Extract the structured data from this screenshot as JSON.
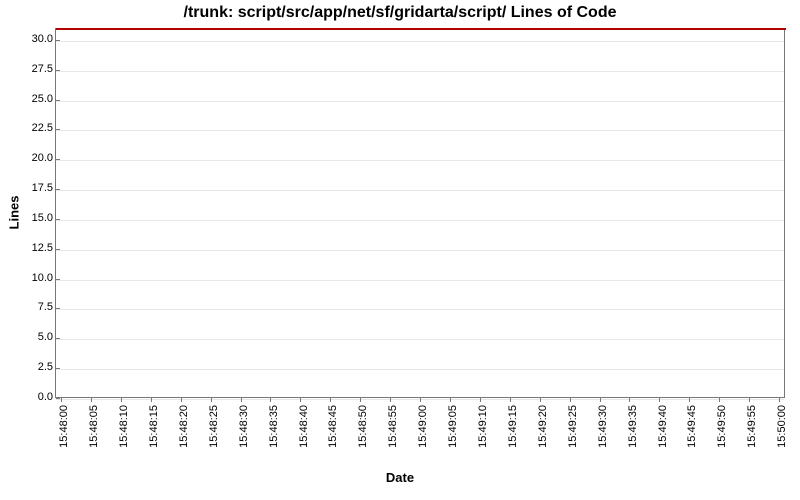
{
  "chart_data": {
    "type": "line",
    "title": "/trunk: script/src/app/net/sf/gridarta/script/ Lines of Code",
    "xlabel": "Date",
    "ylabel": "Lines",
    "ylim": [
      0.0,
      31.0
    ],
    "y_ticks": [
      0.0,
      2.5,
      5.0,
      7.5,
      10.0,
      12.5,
      15.0,
      17.5,
      20.0,
      22.5,
      25.0,
      27.5,
      30.0
    ],
    "x_categories": [
      "15:48:00",
      "15:48:05",
      "15:48:10",
      "15:48:15",
      "15:48:20",
      "15:48:25",
      "15:48:30",
      "15:48:35",
      "15:48:40",
      "15:48:45",
      "15:48:50",
      "15:48:55",
      "15:49:00",
      "15:49:05",
      "15:49:10",
      "15:49:15",
      "15:49:20",
      "15:49:25",
      "15:49:30",
      "15:49:35",
      "15:49:40",
      "15:49:45",
      "15:49:50",
      "15:49:55",
      "15:50:00"
    ],
    "series": [
      {
        "name": "Lines of Code",
        "color": "#b00000",
        "values": [
          31,
          31,
          31,
          31,
          31,
          31,
          31,
          31,
          31,
          31,
          31,
          31,
          31,
          31,
          31,
          31,
          31,
          31,
          31,
          31,
          31,
          31,
          31,
          31,
          31
        ]
      }
    ]
  }
}
